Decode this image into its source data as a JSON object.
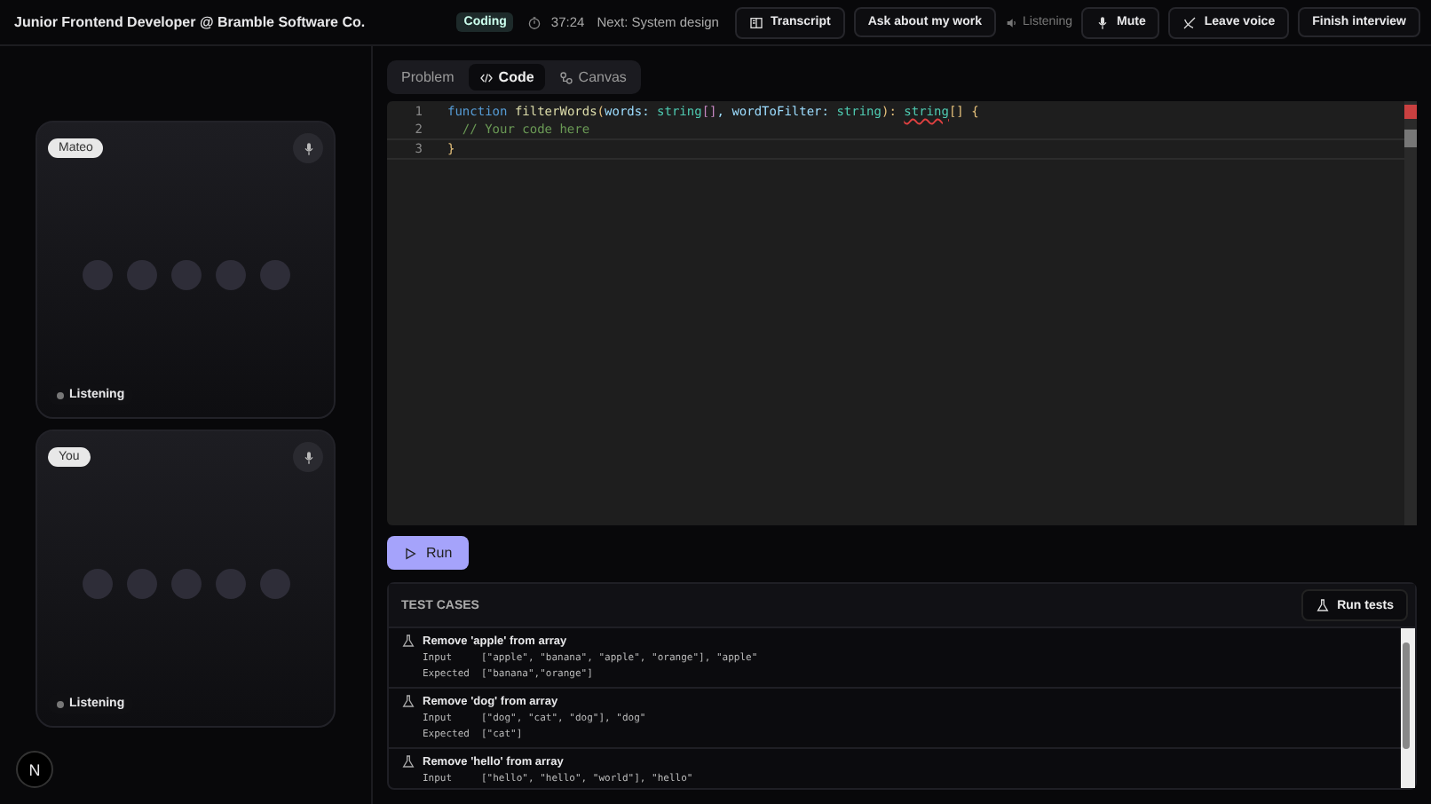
{
  "header": {
    "title": "Junior Frontend Developer @ Bramble Software Co.",
    "phase": "Coding",
    "timer": "37:24",
    "next": "Next: System design",
    "actions": [
      {
        "label": "Transcript",
        "kind": "transcript"
      },
      {
        "label": "Ask about my work",
        "kind": "plain"
      },
      {
        "label": "Listening",
        "kind": "status"
      },
      {
        "label": "Mute",
        "kind": "mic"
      },
      {
        "label": "Leave voice",
        "kind": "leave"
      },
      {
        "label": "Finish interview",
        "kind": "plain"
      }
    ]
  },
  "participants": [
    {
      "name": "Mateo",
      "status": "Listening"
    },
    {
      "name": "You",
      "status": "Listening"
    }
  ],
  "logo": "N",
  "tabs": [
    {
      "label": "Problem",
      "kind": "text",
      "selected": false
    },
    {
      "label": "Code",
      "kind": "code",
      "selected": true
    },
    {
      "label": "Canvas",
      "kind": "canvas",
      "selected": false
    }
  ],
  "editor": {
    "lines": [
      {
        "number": "1",
        "tokens": [
          {
            "text": "function ",
            "kind": "keyword"
          },
          {
            "text": "filterWords",
            "kind": "name"
          },
          {
            "text": "(",
            "kind": "paren"
          },
          {
            "text": "words: ",
            "kind": "param"
          },
          {
            "text": "string",
            "kind": "type"
          },
          {
            "text": "[]",
            "kind": "bracket"
          },
          {
            "text": ", wordToFilter: ",
            "kind": "param"
          },
          {
            "text": "string",
            "kind": "type"
          },
          {
            "text": "): ",
            "kind": "paren"
          },
          {
            "text": "string",
            "kind": "error"
          },
          {
            "text": "[] {",
            "kind": "paren"
          }
        ]
      },
      {
        "number": "2",
        "tokens": [
          {
            "text": "  // Your code here",
            "kind": "comment"
          }
        ]
      },
      {
        "number": "3",
        "tokens": [
          {
            "text": "}",
            "kind": "paren"
          }
        ]
      }
    ]
  },
  "run_button": "Run",
  "tests": {
    "heading": "TEST CASES",
    "run_all": "Run tests",
    "cases": [
      {
        "title": "Remove 'apple' from array",
        "input_label": "Input",
        "input": "[\"apple\", \"banana\", \"apple\", \"orange\"], \"apple\"",
        "expected_label": "Expected",
        "expected": "[\"banana\",\"orange\"]"
      },
      {
        "title": "Remove 'dog' from array",
        "input_label": "Input",
        "input": "[\"dog\", \"cat\", \"dog\"], \"dog\"",
        "expected_label": "Expected",
        "expected": "[\"cat\"]"
      },
      {
        "title": "Remove 'hello' from array",
        "input_label": "Input",
        "input": "[\"hello\", \"hello\", \"world\"], \"hello\""
      }
    ]
  }
}
